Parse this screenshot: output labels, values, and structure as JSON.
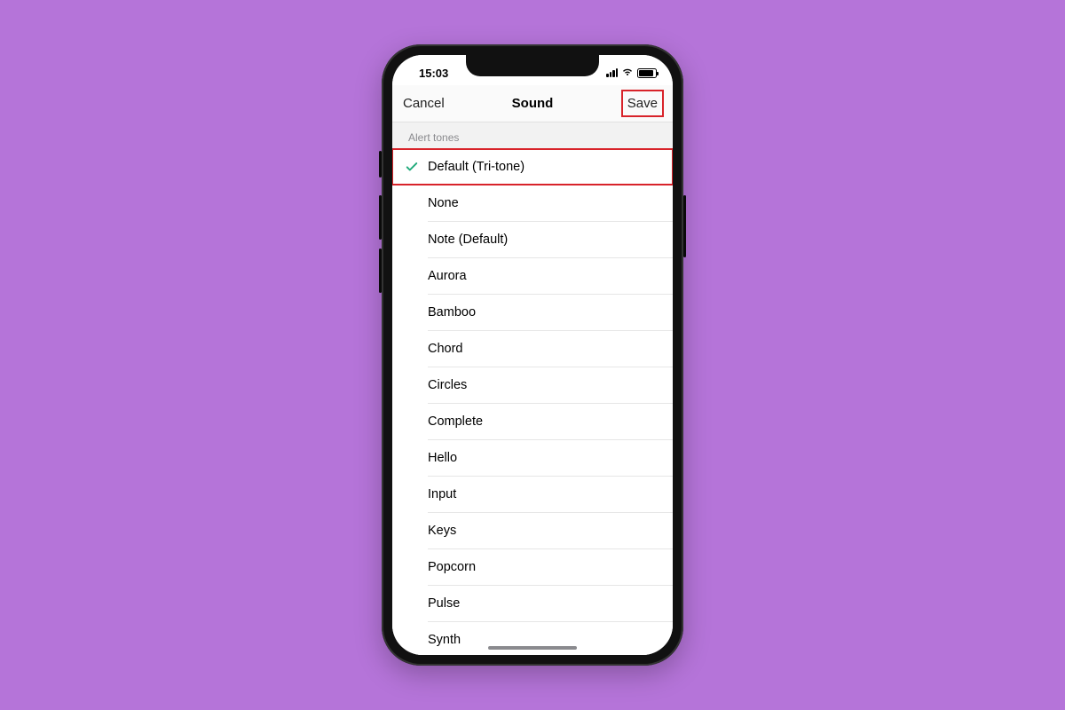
{
  "status": {
    "time": "15:03"
  },
  "nav": {
    "cancel": "Cancel",
    "title": "Sound",
    "save": "Save"
  },
  "section_header": "Alert tones",
  "selected_index": 0,
  "highlight_row_index": 0,
  "highlight_save": true,
  "colors": {
    "highlight": "#d8232a",
    "check": "#1fa97a",
    "background": "#b574d9"
  },
  "tones": [
    "Default (Tri-tone)",
    "None",
    "Note (Default)",
    "Aurora",
    "Bamboo",
    "Chord",
    "Circles",
    "Complete",
    "Hello",
    "Input",
    "Keys",
    "Popcorn",
    "Pulse",
    "Synth"
  ]
}
